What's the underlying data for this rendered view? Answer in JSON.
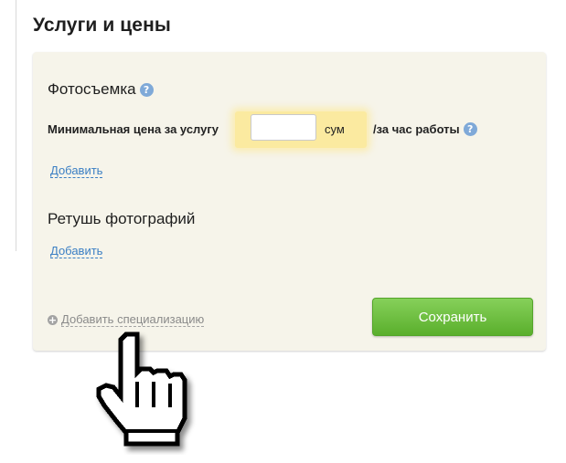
{
  "section": {
    "title": "Услуги и цены"
  },
  "specializations": [
    {
      "title": "Фотосъемка",
      "has_help": true,
      "price_label": "Минимальная цена за услугу",
      "price_value": "",
      "currency": "сум",
      "unit_label": "/за час работы",
      "add_label": "Добавить"
    },
    {
      "title": "Ретушь фотографий",
      "add_label": "Добавить"
    }
  ],
  "help_icon_glyph": "?",
  "add_specialization": {
    "icon": "plus-circle-icon",
    "label": "Добавить специализацию"
  },
  "save_button": {
    "label": "Сохранить",
    "color": "#6ec043"
  },
  "colors": {
    "panel_bg": "#f6f4ea",
    "link": "#3b7fc4",
    "highlight": "#fbeaa0",
    "help_icon": "#7fa9d8"
  },
  "cursor": "hand-pointer-icon"
}
